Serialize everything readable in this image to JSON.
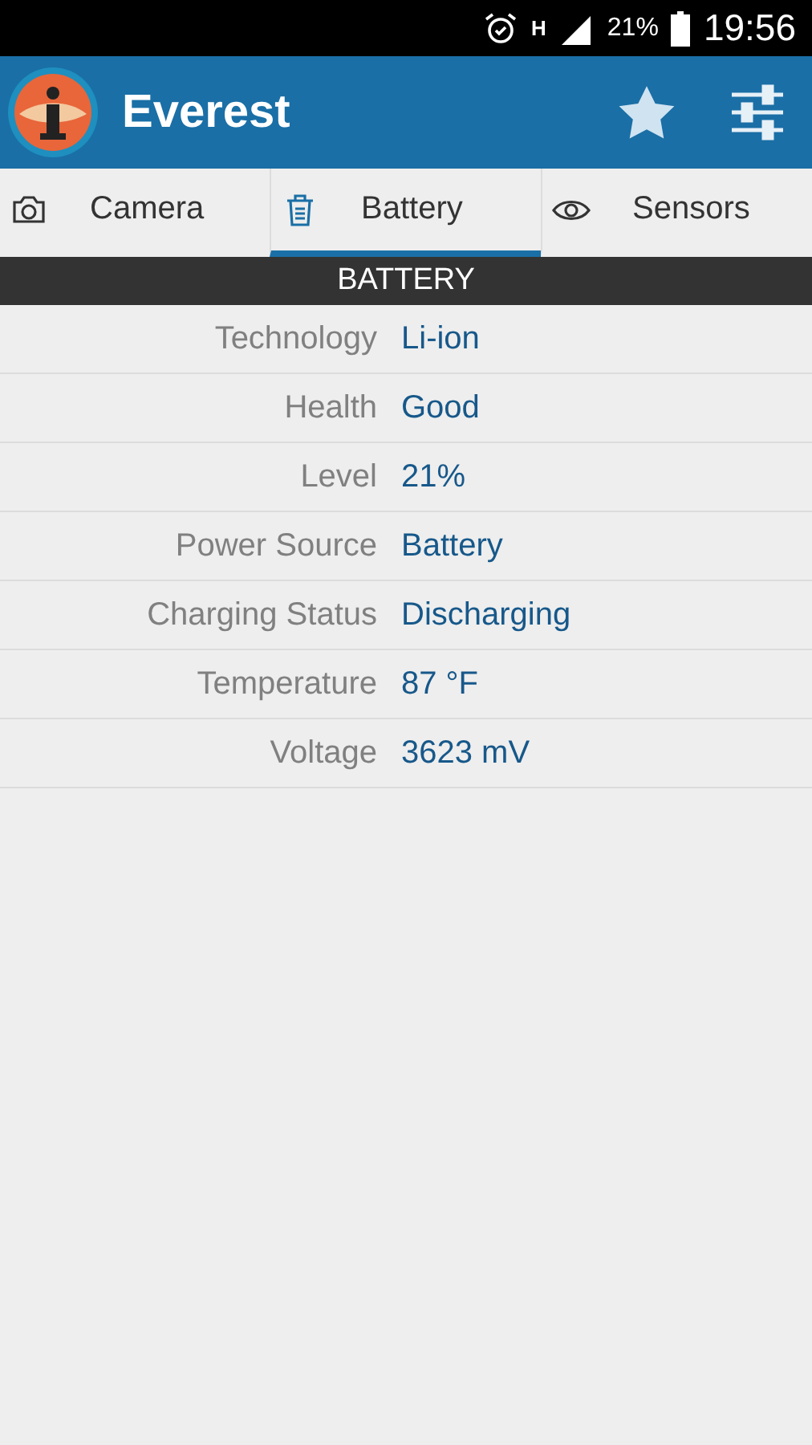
{
  "status_bar": {
    "network": "H",
    "battery": "21%",
    "time": "19:56"
  },
  "app_bar": {
    "title": "Everest"
  },
  "tabs": [
    {
      "label": "Camera",
      "selected": false
    },
    {
      "label": "Battery",
      "selected": true
    },
    {
      "label": "Sensors",
      "selected": false
    }
  ],
  "section": {
    "title": "BATTERY"
  },
  "rows": [
    {
      "label": "Technology",
      "value": "Li-ion"
    },
    {
      "label": "Health",
      "value": "Good"
    },
    {
      "label": "Level",
      "value": "21%"
    },
    {
      "label": "Power Source",
      "value": "Battery"
    },
    {
      "label": "Charging Status",
      "value": "Discharging"
    },
    {
      "label": "Temperature",
      "value": "87 °F"
    },
    {
      "label": "Voltage",
      "value": "3623 mV"
    }
  ]
}
